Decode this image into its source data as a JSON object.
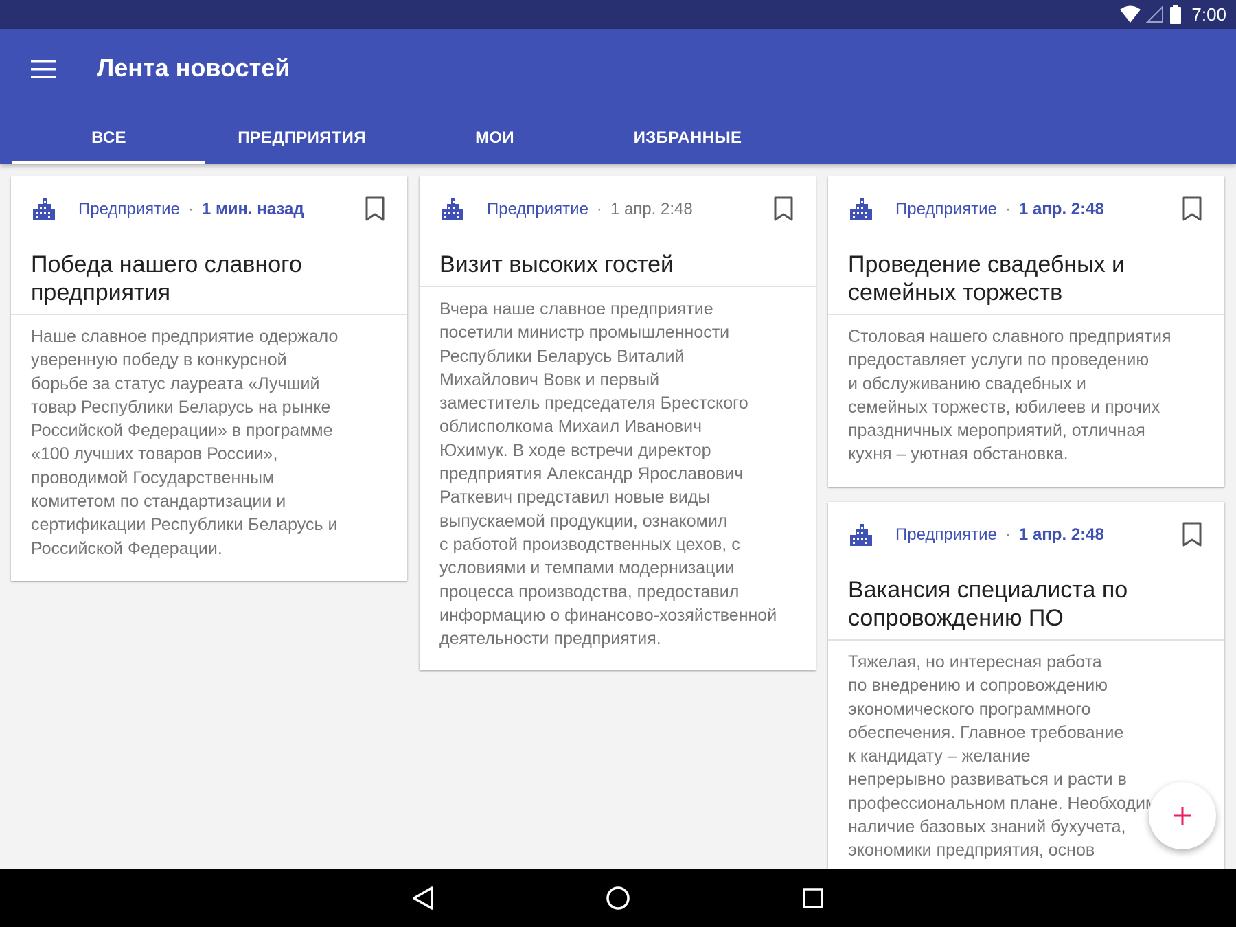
{
  "status_bar": {
    "time": "7:00",
    "icons": [
      "wifi-icon",
      "signal-icon",
      "battery-icon"
    ]
  },
  "app_bar": {
    "title": "Лента новостей",
    "menu_icon": "menu-icon"
  },
  "tabs": [
    {
      "label": "ВСЕ",
      "active": true
    },
    {
      "label": "ПРЕДПРИЯТИЯ",
      "active": false
    },
    {
      "label": "МОИ",
      "active": false
    },
    {
      "label": "ИЗБРАННЫЕ",
      "active": false
    }
  ],
  "cards": [
    {
      "category": "Предприятие",
      "time": "1 мин. назад",
      "title_lines": [
        "Победа нашего славного",
        "предприятия"
      ],
      "body_lines": [
        "Наше славное предприятие одержало",
        "уверенную победу в конкурсной",
        "борьбе за статус лауреата «Лучший",
        "товар Республики Беларусь на рынке",
        "Российской Федерации» в программе",
        "«100 лучших товаров России»,",
        "проводимой Государственным",
        "комитетом по стандартизации и",
        "сертификации Республики Беларусь и",
        "Российской Федерации."
      ]
    },
    {
      "category": "Предприятие",
      "time": "1 апр. 2:48",
      "title_lines": [
        "Визит высоких гостей"
      ],
      "body_lines": [
        "Вчера наше славное предприятие",
        "посетили министр промышленности",
        "Республики Беларусь Виталий",
        "Михайлович Вовк и первый",
        "заместитель председателя Брестского",
        "облисполкома Михаил Иванович",
        "Юхимук. В ходе встречи директор",
        "предприятия Александр Ярославович",
        "Раткевич представил новые виды",
        "выпускаемой продукции, ознакомил",
        "с работой производственных цехов, с",
        "условиями и темпами модернизации",
        "процесса производства, предоставил",
        "информацию о финансово-хозяйственной",
        "деятельности предприятия."
      ]
    },
    {
      "category": "Предприятие",
      "time": "1 апр. 2:48",
      "title_lines": [
        "Проведение свадебных и",
        "семейных торжеств"
      ],
      "body_lines": [
        "Столовая нашего славного предприятия",
        "предоставляет услуги по проведению",
        "и обслуживанию свадебных и",
        "семейных торжеств, юбилеев и прочих",
        "праздничных мероприятий, отличная",
        "кухня – уютная обстановка."
      ]
    },
    {
      "category": "Предприятие",
      "time": "1 апр. 2:48",
      "title_lines": [
        "Вакансия специалиста по",
        "сопровождению ПО"
      ],
      "body_lines": [
        "Тяжелая, но интересная работа",
        "по внедрению и сопровождению",
        "экономического программного",
        "обеспечения. Главное требование",
        "к кандидату – желание",
        "непрерывно развиваться и расти в",
        "профессиональном плане. Необходимо",
        "наличие базовых знаний бухучета,",
        "экономики предприятия, основ"
      ]
    }
  ],
  "fab": {
    "icon": "plus-icon",
    "color": "#e91e63"
  },
  "nav_bar": {
    "icons": [
      "back-icon",
      "home-icon",
      "recents-icon"
    ]
  },
  "colors": {
    "primary": "#3f51b5",
    "status_bar": "#283072",
    "accent": "#e91e63",
    "background": "#f3f3f3"
  }
}
